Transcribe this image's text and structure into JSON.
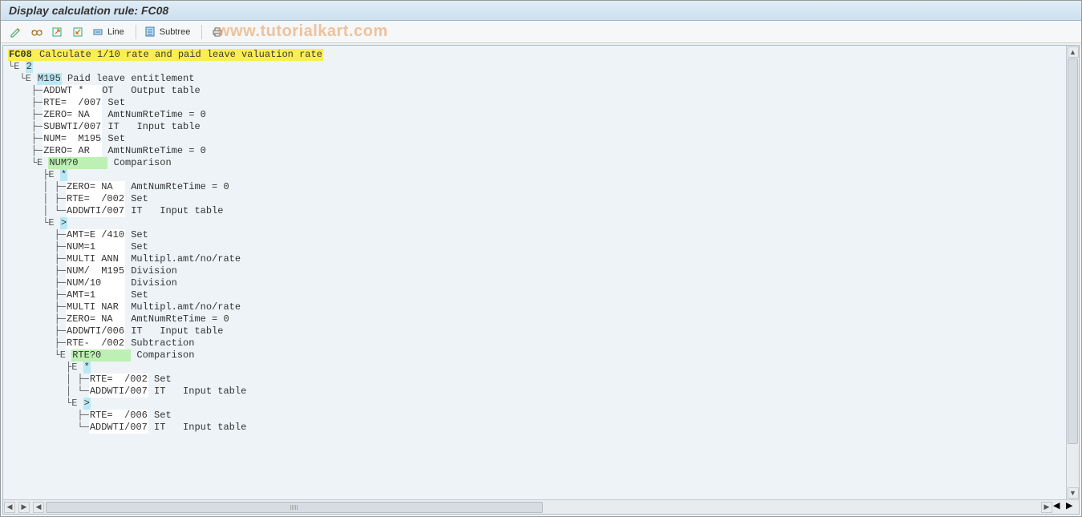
{
  "title": "Display calculation rule: FC08",
  "toolbar": {
    "line_label": "Line",
    "subtree_label": "Subtree"
  },
  "watermark": "www.tutorialkart.com",
  "tree": {
    "root_code": "FC08",
    "root_text": "Calculate 1/10 rate and paid leave valuation rate",
    "lines": [
      {
        "ind": 0,
        "pfx": "",
        "type": "root"
      },
      {
        "ind": 0,
        "pfx": "└E ",
        "ops": [
          {
            "t": "2",
            "cls": "hl-cyan"
          }
        ]
      },
      {
        "ind": 1,
        "pfx": "└E ",
        "ops": [
          {
            "t": "M195",
            "cls": "hl-cyan"
          },
          {
            "t": " Paid leave entitlement"
          }
        ]
      },
      {
        "ind": 2,
        "pfx": "├─",
        "ops": [
          {
            "t": "ADDWT *   ",
            "cls": "hl-white"
          },
          {
            "t": "OT   Output table"
          }
        ]
      },
      {
        "ind": 2,
        "pfx": "├─",
        "ops": [
          {
            "t": "RTE=  /007",
            "cls": "hl-white"
          },
          {
            "t": " Set"
          }
        ]
      },
      {
        "ind": 2,
        "pfx": "├─",
        "ops": [
          {
            "t": "ZERO= NA  ",
            "cls": "hl-white"
          },
          {
            "t": " AmtNumRteTime = 0"
          }
        ]
      },
      {
        "ind": 2,
        "pfx": "├─",
        "ops": [
          {
            "t": "SUBWTI/007",
            "cls": "hl-white"
          },
          {
            "t": " IT   Input table"
          }
        ]
      },
      {
        "ind": 2,
        "pfx": "├─",
        "ops": [
          {
            "t": "NUM=  M195",
            "cls": "hl-white"
          },
          {
            "t": " Set"
          }
        ]
      },
      {
        "ind": 2,
        "pfx": "├─",
        "ops": [
          {
            "t": "ZERO= AR  ",
            "cls": "hl-white"
          },
          {
            "t": " AmtNumRteTime = 0"
          }
        ]
      },
      {
        "ind": 2,
        "pfx": "└E ",
        "ops": [
          {
            "t": "NUM?0     ",
            "cls": "hl-green"
          },
          {
            "t": " Comparison"
          }
        ]
      },
      {
        "ind": 3,
        "pfx": "├E ",
        "ops": [
          {
            "t": "*",
            "cls": "hl-cyan"
          }
        ]
      },
      {
        "ind": 3,
        "pfx": "│ ├─",
        "ind2": true,
        "ops": [
          {
            "t": "ZERO= NA  ",
            "cls": "hl-white"
          },
          {
            "t": " AmtNumRteTime = 0"
          }
        ]
      },
      {
        "ind": 3,
        "pfx": "│ ├─",
        "ind2": true,
        "ops": [
          {
            "t": "RTE=  /002",
            "cls": "hl-white"
          },
          {
            "t": " Set"
          }
        ]
      },
      {
        "ind": 3,
        "pfx": "│ └─",
        "ind2": true,
        "ops": [
          {
            "t": "ADDWTI/007",
            "cls": "hl-white"
          },
          {
            "t": " IT   Input table"
          }
        ]
      },
      {
        "ind": 3,
        "pfx": "└E ",
        "ops": [
          {
            "t": ">",
            "cls": "hl-cyan"
          }
        ]
      },
      {
        "ind": 4,
        "pfx": "├─",
        "ops": [
          {
            "t": "AMT=E /410",
            "cls": "hl-white"
          },
          {
            "t": " Set"
          }
        ]
      },
      {
        "ind": 4,
        "pfx": "├─",
        "ops": [
          {
            "t": "NUM=1     ",
            "cls": "hl-white"
          },
          {
            "t": " Set"
          }
        ]
      },
      {
        "ind": 4,
        "pfx": "├─",
        "ops": [
          {
            "t": "MULTI ANN ",
            "cls": "hl-white"
          },
          {
            "t": " Multipl.amt/no/rate"
          }
        ]
      },
      {
        "ind": 4,
        "pfx": "├─",
        "ops": [
          {
            "t": "NUM/  M195",
            "cls": "hl-white"
          },
          {
            "t": " Division"
          }
        ]
      },
      {
        "ind": 4,
        "pfx": "├─",
        "ops": [
          {
            "t": "NUM/10    ",
            "cls": "hl-white"
          },
          {
            "t": " Division"
          }
        ]
      },
      {
        "ind": 4,
        "pfx": "├─",
        "ops": [
          {
            "t": "AMT=1     ",
            "cls": "hl-white"
          },
          {
            "t": " Set"
          }
        ]
      },
      {
        "ind": 4,
        "pfx": "├─",
        "ops": [
          {
            "t": "MULTI NAR ",
            "cls": "hl-white"
          },
          {
            "t": " Multipl.amt/no/rate"
          }
        ]
      },
      {
        "ind": 4,
        "pfx": "├─",
        "ops": [
          {
            "t": "ZERO= NA  ",
            "cls": "hl-white"
          },
          {
            "t": " AmtNumRteTime = 0"
          }
        ]
      },
      {
        "ind": 4,
        "pfx": "├─",
        "ops": [
          {
            "t": "ADDWTI/006",
            "cls": "hl-white"
          },
          {
            "t": " IT   Input table"
          }
        ]
      },
      {
        "ind": 4,
        "pfx": "├─",
        "ops": [
          {
            "t": "RTE-  /002",
            "cls": "hl-white"
          },
          {
            "t": " Subtraction"
          }
        ]
      },
      {
        "ind": 4,
        "pfx": "└E ",
        "ops": [
          {
            "t": "RTE?0     ",
            "cls": "hl-green"
          },
          {
            "t": " Comparison"
          }
        ]
      },
      {
        "ind": 5,
        "pfx": "├E ",
        "ops": [
          {
            "t": "*",
            "cls": "hl-cyan"
          }
        ]
      },
      {
        "ind": 5,
        "pfx": "│ ├─",
        "ind2": true,
        "ops": [
          {
            "t": "RTE=  /002",
            "cls": "hl-white"
          },
          {
            "t": " Set"
          }
        ]
      },
      {
        "ind": 5,
        "pfx": "│ └─",
        "ind2": true,
        "ops": [
          {
            "t": "ADDWTI/007",
            "cls": "hl-white"
          },
          {
            "t": " IT   Input table"
          }
        ]
      },
      {
        "ind": 5,
        "pfx": "└E ",
        "ops": [
          {
            "t": ">",
            "cls": "hl-cyan"
          }
        ]
      },
      {
        "ind": 6,
        "pfx": "├─",
        "ops": [
          {
            "t": "RTE=  /006",
            "cls": "hl-white"
          },
          {
            "t": " Set"
          }
        ]
      },
      {
        "ind": 6,
        "pfx": "└─",
        "ops": [
          {
            "t": "ADDWTI/007",
            "cls": "hl-white"
          },
          {
            "t": " IT   Input table"
          }
        ]
      }
    ]
  }
}
